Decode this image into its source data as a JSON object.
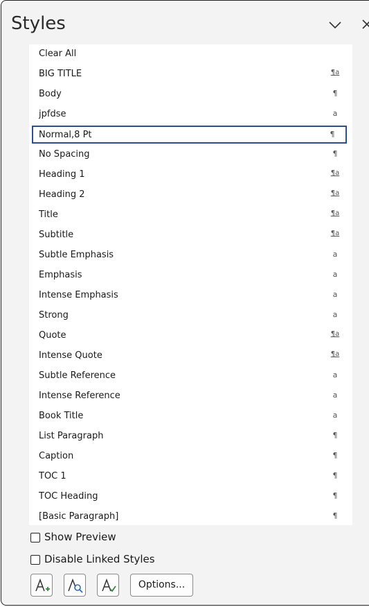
{
  "pane": {
    "title": "Styles"
  },
  "styles": [
    {
      "label": "Clear All",
      "glyph": ""
    },
    {
      "label": "BIG TITLE",
      "glyph": "¶a"
    },
    {
      "label": "Body",
      "glyph": "¶"
    },
    {
      "label": "jpfdse",
      "glyph": "a"
    },
    {
      "label": "Normal,8 Pt",
      "glyph": "¶",
      "selected": true
    },
    {
      "label": "No Spacing",
      "glyph": "¶"
    },
    {
      "label": "Heading 1",
      "glyph": "¶a"
    },
    {
      "label": "Heading 2",
      "glyph": "¶a"
    },
    {
      "label": "Title",
      "glyph": "¶a"
    },
    {
      "label": "Subtitle",
      "glyph": "¶a"
    },
    {
      "label": "Subtle Emphasis",
      "glyph": "a"
    },
    {
      "label": "Emphasis",
      "glyph": "a"
    },
    {
      "label": "Intense Emphasis",
      "glyph": "a"
    },
    {
      "label": "Strong",
      "glyph": "a"
    },
    {
      "label": "Quote",
      "glyph": "¶a"
    },
    {
      "label": "Intense Quote",
      "glyph": "¶a"
    },
    {
      "label": "Subtle Reference",
      "glyph": "a"
    },
    {
      "label": "Intense Reference",
      "glyph": "a"
    },
    {
      "label": "Book Title",
      "glyph": "a"
    },
    {
      "label": "List Paragraph",
      "glyph": "¶"
    },
    {
      "label": "Caption",
      "glyph": "¶"
    },
    {
      "label": "TOC 1",
      "glyph": "¶"
    },
    {
      "label": "TOC Heading",
      "glyph": "¶"
    },
    {
      "label": "[Basic Paragraph]",
      "glyph": "¶"
    }
  ],
  "options": {
    "show_preview": {
      "label": "Show Preview",
      "checked": false
    },
    "disable_linked": {
      "label": "Disable Linked Styles",
      "checked": false
    }
  },
  "buttons": {
    "options_label": "Options...",
    "new_style_icon": "new-style-icon",
    "style_inspector_icon": "style-inspector-icon",
    "manage_styles_icon": "manage-styles-icon"
  },
  "colors": {
    "selected_border": "#2e4f8f",
    "icon_blue": "#2b6cc4",
    "icon_green": "#2e8b3a"
  }
}
